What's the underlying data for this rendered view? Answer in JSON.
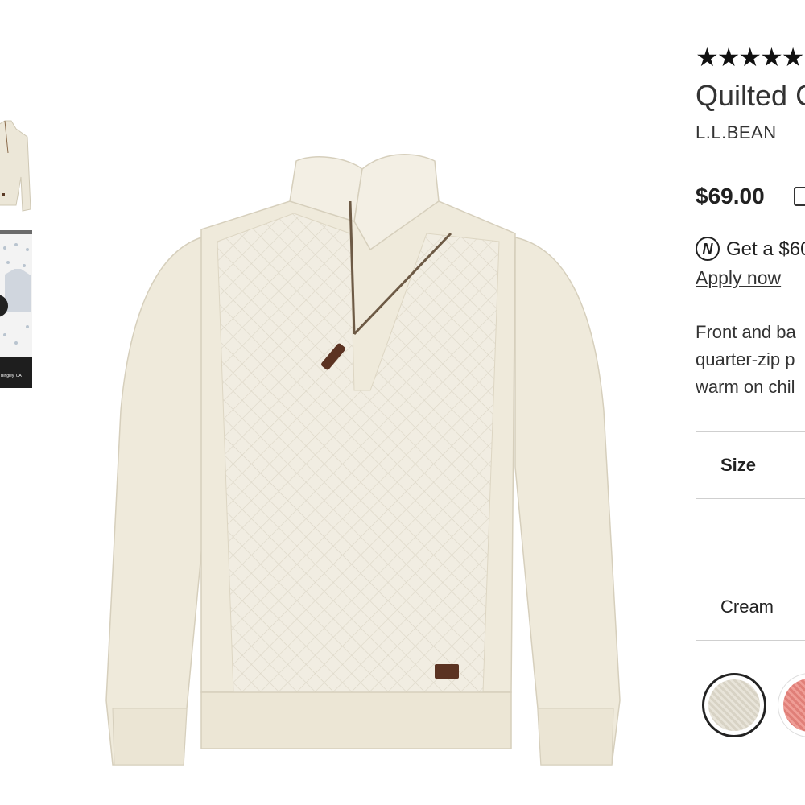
{
  "product": {
    "stars": "★★★★★",
    "title": "Quilted C",
    "brand": "L.L.BEAN",
    "price": "$69.00",
    "offer_text": "Get a $60",
    "offer_icon": "N",
    "apply_label": "Apply now",
    "description": [
      "Front and ba",
      "quarter-zip p",
      "warm on chil"
    ]
  },
  "options": {
    "size_label": "Size",
    "color_value": "Cream",
    "swatches": [
      {
        "name": "cream",
        "color": "#e3decf",
        "selected": true
      },
      {
        "name": "coral",
        "color": "#e88e87",
        "selected": false
      }
    ]
  },
  "gallery": {
    "video_caption": "Bingley, CA"
  },
  "colors": {
    "text": "#333333",
    "border": "#cfcfcf",
    "garment": "#efeadb"
  }
}
